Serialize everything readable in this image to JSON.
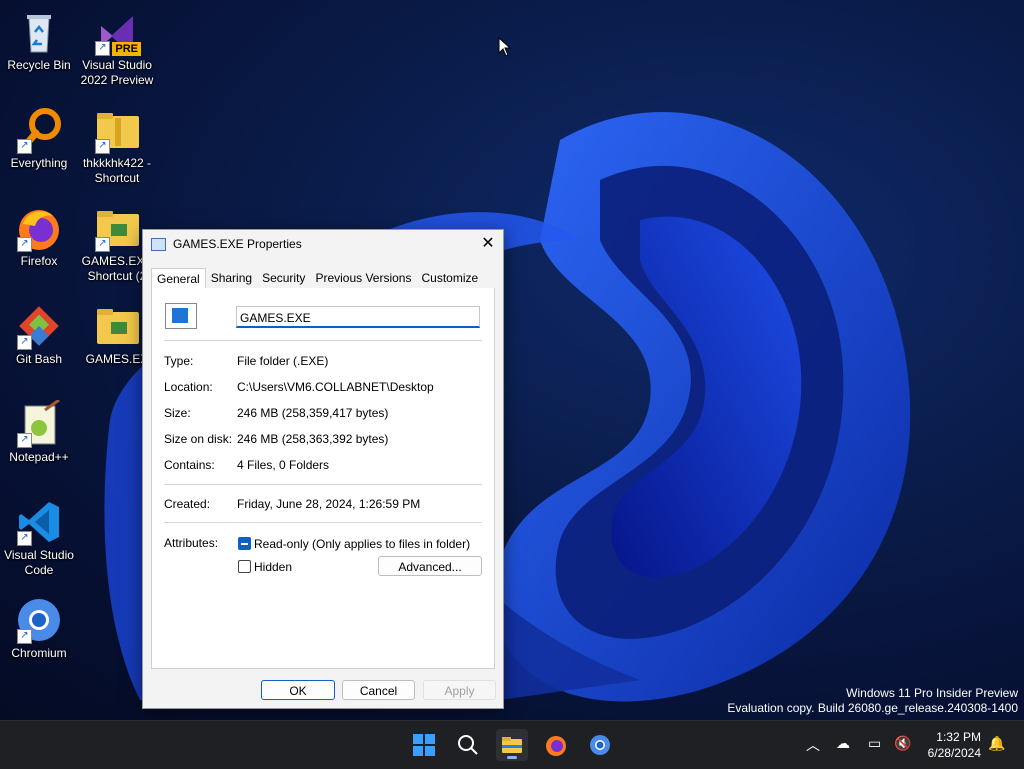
{
  "desktop": {
    "icons": [
      {
        "label": "Recycle Bin",
        "icon": "recycle-bin-icon"
      },
      {
        "label": "Visual Studio 2022 Preview",
        "icon": "visual-studio-icon",
        "badge": "PRE"
      },
      {
        "label": "Everything",
        "icon": "search-magnifier-icon"
      },
      {
        "label": "thkkkhk422 - Shortcut",
        "icon": "zip-folder-icon"
      },
      {
        "label": "Firefox",
        "icon": "firefox-icon"
      },
      {
        "label": "GAMES.EXE Shortcut (2",
        "icon": "folder-icon"
      },
      {
        "label": "Git Bash",
        "icon": "git-bash-icon"
      },
      {
        "label": "GAMES.EX",
        "icon": "folder-icon"
      },
      {
        "label": "Notepad++",
        "icon": "notepad-plus-plus-icon"
      },
      {
        "label": "Visual Studio Code",
        "icon": "vscode-icon"
      },
      {
        "label": "Chromium",
        "icon": "chromium-icon"
      }
    ]
  },
  "watermark": {
    "line1": "Windows 11 Pro Insider Preview",
    "line2": "Evaluation copy. Build 26080.ge_release.240308-1400"
  },
  "dialog": {
    "title": "GAMES.EXE Properties",
    "tabs": [
      "General",
      "Sharing",
      "Security",
      "Previous Versions",
      "Customize"
    ],
    "active_tab": "General",
    "name_value": "GAMES.EXE",
    "fields": {
      "type_label": "Type:",
      "type_value": "File folder (.EXE)",
      "location_label": "Location:",
      "location_value": "C:\\Users\\VM6.COLLABNET\\Desktop",
      "size_label": "Size:",
      "size_value": "246 MB (258,359,417 bytes)",
      "size_on_disk_label": "Size on disk:",
      "size_on_disk_value": "246 MB (258,363,392 bytes)",
      "contains_label": "Contains:",
      "contains_value": "4 Files, 0 Folders",
      "created_label": "Created:",
      "created_value": "Friday, June 28, 2024, 1:26:59 PM",
      "attributes_label": "Attributes:"
    },
    "attributes": {
      "readonly_label": "Read-only (Only applies to files in folder)",
      "readonly_state": "indeterminate",
      "hidden_label": "Hidden",
      "hidden_checked": false,
      "advanced_label": "Advanced..."
    },
    "buttons": {
      "ok": "OK",
      "cancel": "Cancel",
      "apply": "Apply"
    }
  },
  "taskbar": {
    "pinned": [
      "start-icon",
      "search-icon",
      "file-explorer-icon",
      "firefox-icon",
      "chromium-icon"
    ],
    "running": "file-explorer-icon",
    "clock_time": "1:32 PM",
    "clock_date": "6/28/2024"
  },
  "colors": {
    "accent": "#0f5fc6",
    "taskbar": "#1f2024"
  }
}
